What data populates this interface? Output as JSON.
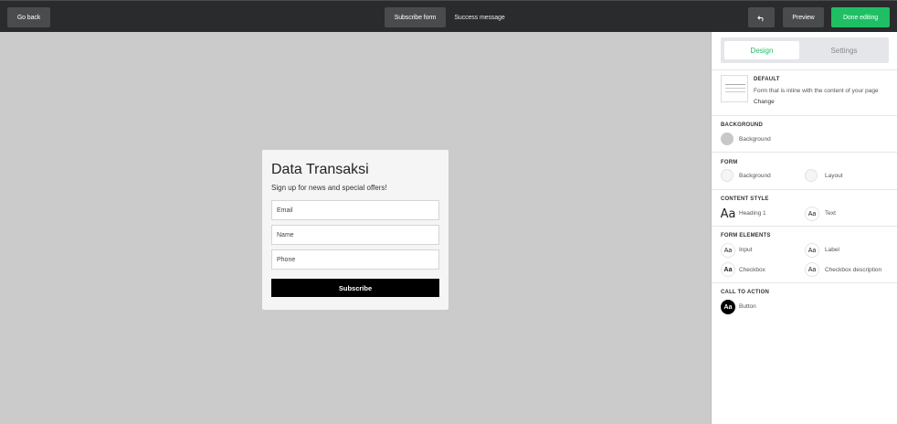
{
  "topbar": {
    "go_back": "Go back",
    "subscribe_form": "Subscribe form",
    "success_message": "Success message",
    "preview": "Preview",
    "done_editing": "Done editing"
  },
  "form": {
    "title": "Data Transaksi",
    "subtitle": "Sign up for news and special offers!",
    "fields": [
      "Email",
      "Name",
      "Phone"
    ],
    "button": "Subscribe"
  },
  "panel": {
    "tabs": [
      "Design",
      "Settings"
    ],
    "layout": {
      "name": "DEFAULT",
      "description": "Form that is inline with the content of your page",
      "change": "Change"
    },
    "background": {
      "heading": "BACKGROUND",
      "label": "Background",
      "color": "#c8c8c8"
    },
    "form_section": {
      "heading": "FORM",
      "background": "Background",
      "layout": "Layout"
    },
    "content_style": {
      "heading": "CONTENT STYLE",
      "heading1": "Heading 1",
      "text": "Text",
      "glyph": "Aa"
    },
    "form_elements": {
      "heading": "FORM ELEMENTS",
      "input": "Input",
      "label": "Label",
      "checkbox": "Checkbox",
      "checkbox_description": "Checkbox description",
      "glyph": "Aa"
    },
    "cta": {
      "heading": "CALL TO ACTION",
      "button": "Button",
      "glyph": "Aa"
    }
  },
  "colors": {
    "accent": "#1fbf63",
    "topbar": "#2a2b2d",
    "canvas": "#cbcbcb"
  }
}
